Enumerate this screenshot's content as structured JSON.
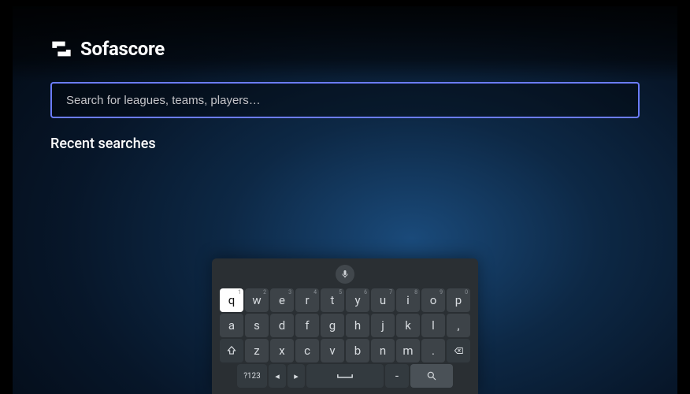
{
  "brand": "Sofascore",
  "search": {
    "placeholder": "Search for leagues, teams, players…",
    "value": ""
  },
  "recent_heading": "Recent searches",
  "keyboard": {
    "row1": [
      {
        "label": "q",
        "hint": "1",
        "highlight": true
      },
      {
        "label": "w",
        "hint": "2"
      },
      {
        "label": "e",
        "hint": "3"
      },
      {
        "label": "r",
        "hint": "4"
      },
      {
        "label": "t",
        "hint": "5"
      },
      {
        "label": "y",
        "hint": "6"
      },
      {
        "label": "u",
        "hint": "7"
      },
      {
        "label": "i",
        "hint": "8"
      },
      {
        "label": "o",
        "hint": "9"
      },
      {
        "label": "p",
        "hint": "0"
      }
    ],
    "row2": [
      {
        "label": "a"
      },
      {
        "label": "s"
      },
      {
        "label": "d"
      },
      {
        "label": "f"
      },
      {
        "label": "g"
      },
      {
        "label": "h"
      },
      {
        "label": "j"
      },
      {
        "label": "k"
      },
      {
        "label": "l"
      },
      {
        "label": ","
      }
    ],
    "row3_shift_icon": "shift",
    "row3": [
      {
        "label": "z"
      },
      {
        "label": "x"
      },
      {
        "label": "c"
      },
      {
        "label": "v"
      },
      {
        "label": "b"
      },
      {
        "label": "n"
      },
      {
        "label": "m"
      },
      {
        "label": "."
      }
    ],
    "row3_backspace_icon": "backspace",
    "row4": {
      "symbols": "?123",
      "left_icon": "◂",
      "right_icon": "▸",
      "space_icon": "⎵",
      "dash": "-",
      "search_icon": "search"
    }
  }
}
